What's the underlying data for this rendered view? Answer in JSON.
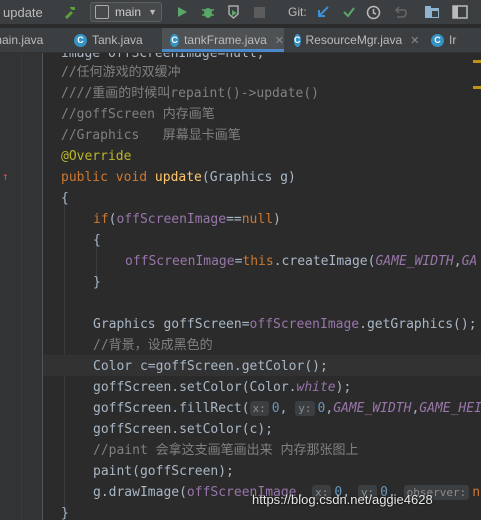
{
  "toolbar": {
    "run_config": "update",
    "branch": "main",
    "git_label": "Git:"
  },
  "tabs": [
    {
      "label": "main.java",
      "active": false
    },
    {
      "label": "Tank.java",
      "active": false
    },
    {
      "label": "tankFrame.java",
      "active": true
    },
    {
      "label": "ResourceMgr.java",
      "active": false
    },
    {
      "label": "Ir",
      "active": false
    }
  ],
  "code": {
    "line0": "image offScreenImage=null;",
    "line1": "//任何游戏的双缓冲",
    "line2": "////重画的时候叫repaint()->update()",
    "line3": "//goffScreen 内存画笔",
    "line4": "//Graphics   屏幕显卡画笔",
    "annotation": "@Override",
    "sig_kw": "public void ",
    "sig_fn": "update",
    "sig_rest": "(Graphics g)",
    "brace_open": "{",
    "if_kw": "if",
    "if_open": "(",
    "if_field": "offScreenImage",
    "if_op": "==",
    "if_null": "null",
    "if_close": ")",
    "inner_open": "{",
    "assign_field": "offScreenImage",
    "assign_eq": "=",
    "assign_this": "this",
    "assign_call": ".createImage(",
    "assign_c1": "GAME_WIDTH",
    "assign_comma": ",",
    "assign_c2": "GA",
    "inner_close": "}",
    "gfx_decl": "Graphics goffScreen=",
    "gfx_field": "offScreenImage",
    "gfx_call": ".getGraphics();",
    "cmt_bg": "//背景，设成黑色的",
    "color_decl": "Color c=goffScreen.getColor();",
    "setcolor_pre": "goffScreen.setColor(Color.",
    "setcolor_const": "white",
    "setcolor_post": ");",
    "fill_pre": "goffScreen.fillRect(",
    "hint_x": "x:",
    "fill_x": "0",
    "fill_comma1": ", ",
    "hint_y": "y:",
    "fill_y": "0",
    "fill_comma2": ",",
    "fill_c1": "GAME_WIDTH",
    "fill_comma3": ",",
    "fill_c2": "GAME_HEI",
    "setc_back": "goffScreen.setColor(c);",
    "cmt_paint": "//paint 会拿这支画笔画出来 内存那张图上",
    "paint_call": "paint(goffScreen);",
    "draw_pre": "g.drawImage(",
    "draw_field": "offScreenImage",
    "draw_comma": ",",
    "draw_hint_x": "x:",
    "draw_x": "0",
    "draw_comma2": ",",
    "draw_hint_y": "y:",
    "draw_y": "0",
    "draw_comma3": ",",
    "draw_hint_obs": "observer:",
    "draw_null": "null",
    "brace_close": "}"
  },
  "watermark": "https://blog.csdn.net/aggie4628",
  "colors": {
    "accent": "#4a88c7",
    "keyword": "#cc7832",
    "field": "#9876aa",
    "comment": "#808080",
    "annotation": "#bbb529",
    "number": "#6897bb",
    "method": "#ffc66d"
  }
}
